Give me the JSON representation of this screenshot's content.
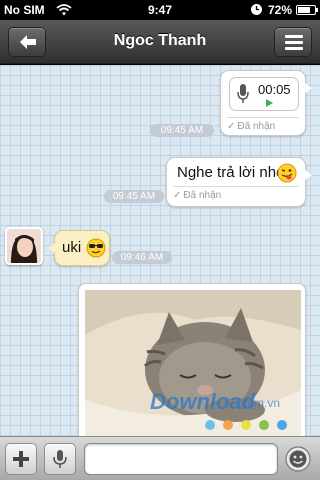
{
  "status_bar": {
    "carrier": "No SIM",
    "time": "9:47",
    "battery": "72%",
    "battery_level": 0.72,
    "icons": [
      "wifi-icon",
      "alarm-icon",
      "battery-icon"
    ]
  },
  "nav": {
    "title": "Ngoc Thanh",
    "back_icon": "arrow-left-icon",
    "menu_icon": "hamburger-menu-icon"
  },
  "messages": [
    {
      "direction": "outgoing",
      "kind": "voice",
      "duration": "00:05",
      "status": "Đã nhận",
      "time": "09:45 AM"
    },
    {
      "direction": "outgoing",
      "kind": "text",
      "text": "Nghe trả lời nhe",
      "emoji": "tongue-out-wink-emoji",
      "status": "Đã nhận",
      "time": "09:45 AM"
    },
    {
      "direction": "incoming",
      "kind": "text",
      "text": "uki",
      "emoji": "sunglasses-emoji",
      "time": "09:46 AM"
    },
    {
      "direction": "outgoing",
      "kind": "image",
      "image": "sleeping-kitten-photo",
      "watermark": "Download",
      "watermark_suffix": ".com.vn"
    }
  ],
  "input_bar": {
    "placeholder": "",
    "value": "",
    "icons": [
      "plus-icon",
      "microphone-icon",
      "smiley-icon"
    ]
  },
  "colors": {
    "chat_background": "#dbe8f2",
    "incoming_bubble": "#fbf0c4",
    "outgoing_bubble": "#ffffff",
    "play_green": "#3fb14a",
    "navbar": "#3a3a3a"
  }
}
